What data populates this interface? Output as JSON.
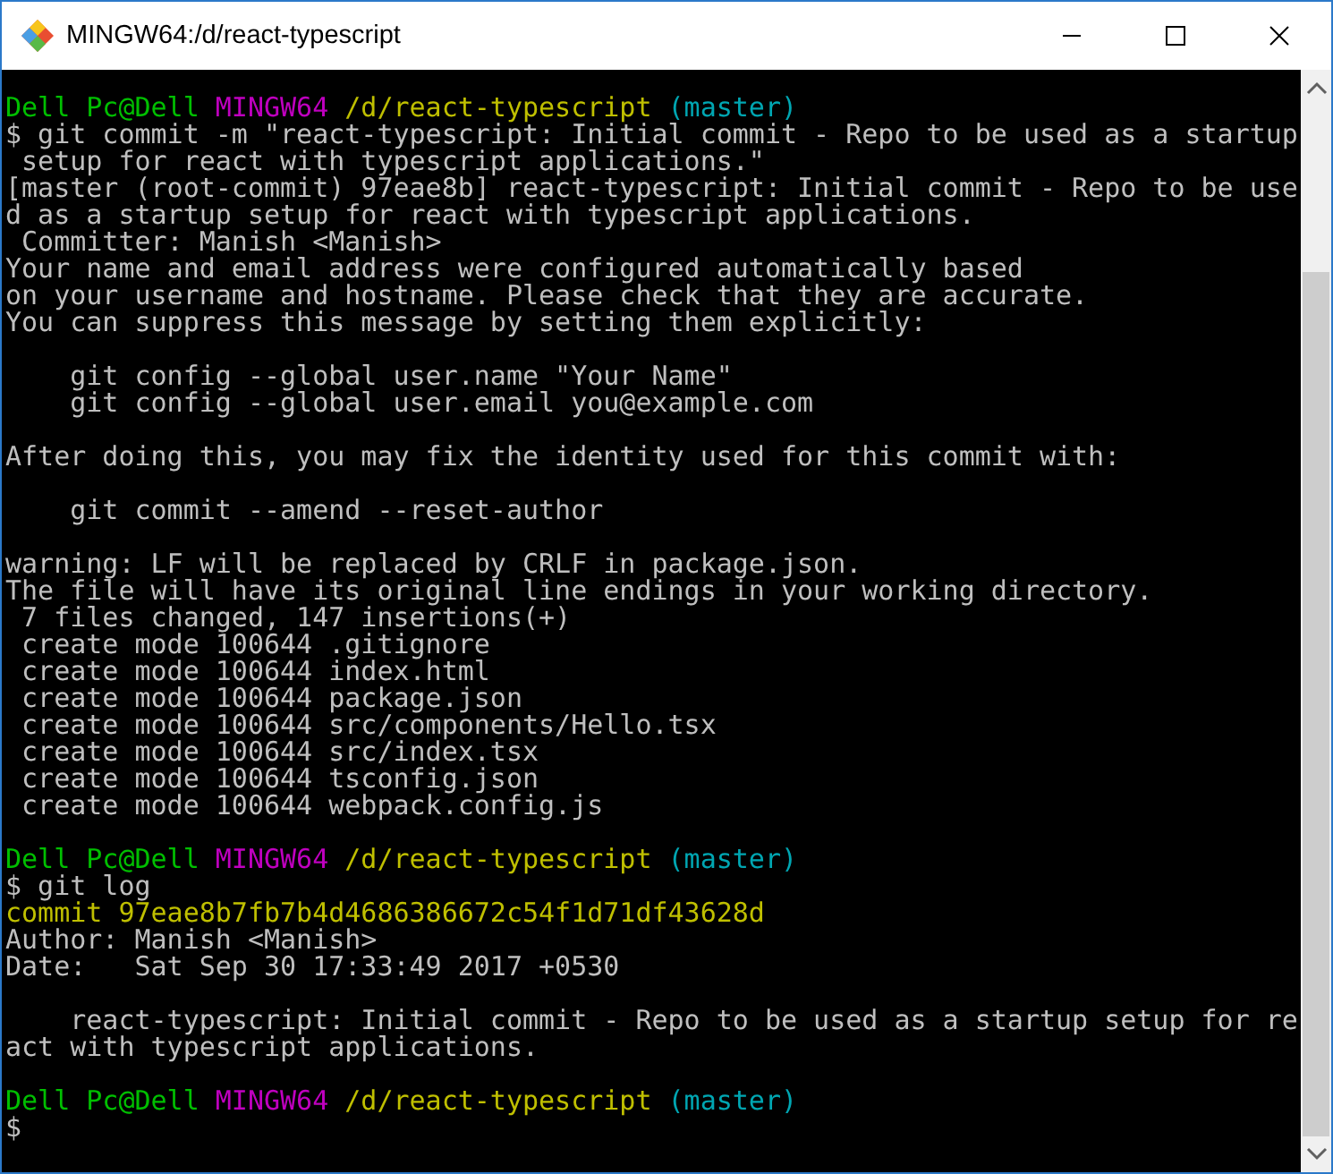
{
  "window": {
    "title": "MINGW64:/d/react-typescript"
  },
  "terminal": {
    "lines": [
      {
        "kind": "prompt",
        "user": "Dell Pc@Dell",
        "host": "MINGW64",
        "path": "/d/react-typescript",
        "branch": "(master)"
      },
      {
        "kind": "output",
        "text": "$ git commit -m \"react-typescript: Initial commit - Repo to be used as a startup"
      },
      {
        "kind": "output",
        "text": " setup for react with typescript applications.\""
      },
      {
        "kind": "output",
        "text": "[master (root-commit) 97eae8b] react-typescript: Initial commit - Repo to be use"
      },
      {
        "kind": "output",
        "text": "d as a startup setup for react with typescript applications."
      },
      {
        "kind": "output",
        "text": " Committer: Manish <Manish>"
      },
      {
        "kind": "output",
        "text": "Your name and email address were configured automatically based"
      },
      {
        "kind": "output",
        "text": "on your username and hostname. Please check that they are accurate."
      },
      {
        "kind": "output",
        "text": "You can suppress this message by setting them explicitly:"
      },
      {
        "kind": "blank"
      },
      {
        "kind": "output",
        "text": "    git config --global user.name \"Your Name\""
      },
      {
        "kind": "output",
        "text": "    git config --global user.email you@example.com"
      },
      {
        "kind": "blank"
      },
      {
        "kind": "output",
        "text": "After doing this, you may fix the identity used for this commit with:"
      },
      {
        "kind": "blank"
      },
      {
        "kind": "output",
        "text": "    git commit --amend --reset-author"
      },
      {
        "kind": "blank"
      },
      {
        "kind": "output",
        "text": "warning: LF will be replaced by CRLF in package.json."
      },
      {
        "kind": "output",
        "text": "The file will have its original line endings in your working directory."
      },
      {
        "kind": "output",
        "text": " 7 files changed, 147 insertions(+)"
      },
      {
        "kind": "output",
        "text": " create mode 100644 .gitignore"
      },
      {
        "kind": "output",
        "text": " create mode 100644 index.html"
      },
      {
        "kind": "output",
        "text": " create mode 100644 package.json"
      },
      {
        "kind": "output",
        "text": " create mode 100644 src/components/Hello.tsx"
      },
      {
        "kind": "output",
        "text": " create mode 100644 src/index.tsx"
      },
      {
        "kind": "output",
        "text": " create mode 100644 tsconfig.json"
      },
      {
        "kind": "output",
        "text": " create mode 100644 webpack.config.js"
      },
      {
        "kind": "blank"
      },
      {
        "kind": "prompt",
        "user": "Dell Pc@Dell",
        "host": "MINGW64",
        "path": "/d/react-typescript",
        "branch": "(master)"
      },
      {
        "kind": "output",
        "text": "$ git log"
      },
      {
        "kind": "commit",
        "text": "commit 97eae8b7fb7b4d4686386672c54f1d71df43628d"
      },
      {
        "kind": "output",
        "text": "Author: Manish <Manish>"
      },
      {
        "kind": "output",
        "text": "Date:   Sat Sep 30 17:33:49 2017 +0530"
      },
      {
        "kind": "blank"
      },
      {
        "kind": "output",
        "text": "    react-typescript: Initial commit - Repo to be used as a startup setup for re"
      },
      {
        "kind": "output",
        "text": "act with typescript applications."
      },
      {
        "kind": "blank"
      },
      {
        "kind": "prompt",
        "user": "Dell Pc@Dell",
        "host": "MINGW64",
        "path": "/d/react-typescript",
        "branch": "(master)"
      },
      {
        "kind": "output",
        "text": "$"
      }
    ]
  }
}
